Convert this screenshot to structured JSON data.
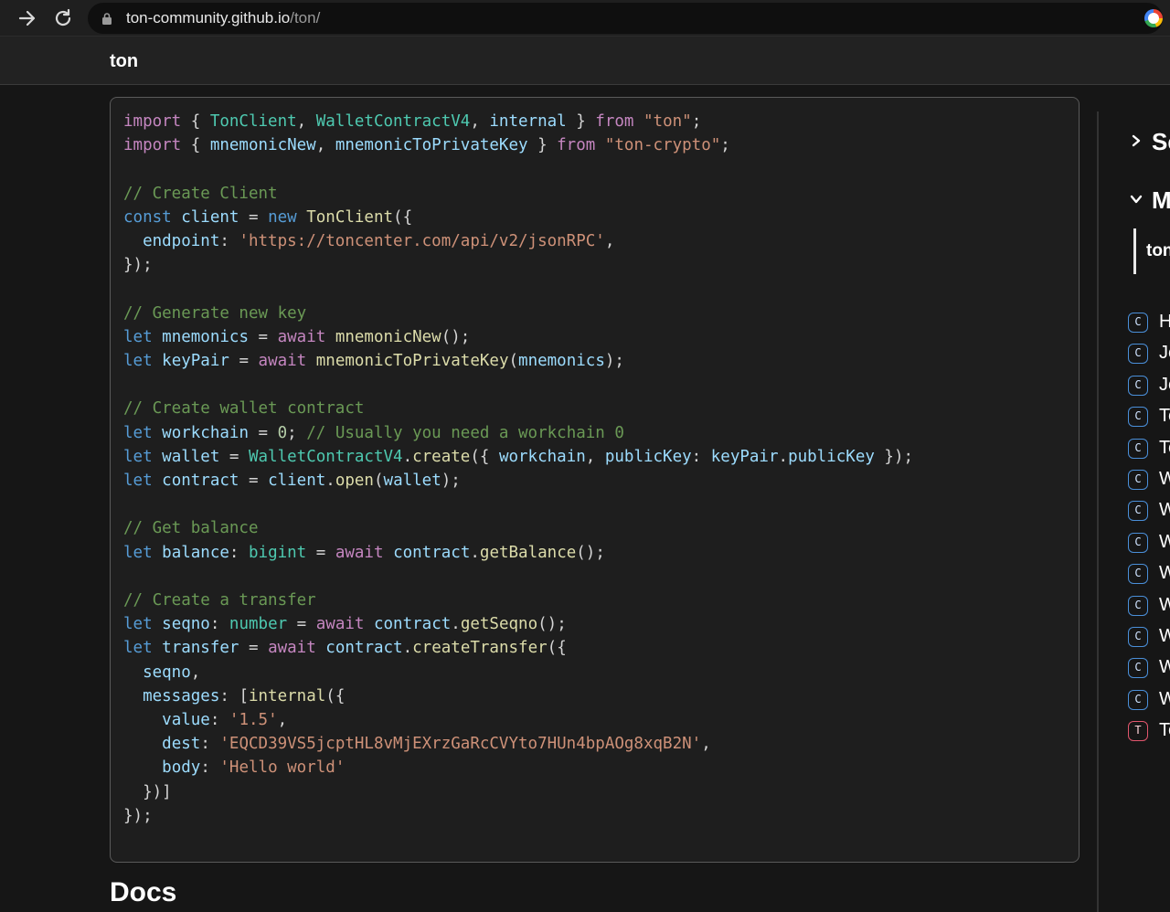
{
  "browser": {
    "url_host": "ton-community.github.io",
    "url_path": "/ton/"
  },
  "header": {
    "title": "ton"
  },
  "code": {
    "lines": [
      [
        [
          "kw",
          "import"
        ],
        [
          "p",
          " { "
        ],
        [
          "ty",
          "TonClient"
        ],
        [
          "p",
          ", "
        ],
        [
          "ty",
          "WalletContractV4"
        ],
        [
          "p",
          ", "
        ],
        [
          "v",
          "internal"
        ],
        [
          "p",
          " } "
        ],
        [
          "kw",
          "from"
        ],
        [
          "p",
          " "
        ],
        [
          "str",
          "\"ton\""
        ],
        [
          "p",
          ";"
        ]
      ],
      [
        [
          "kw",
          "import"
        ],
        [
          "p",
          " { "
        ],
        [
          "v",
          "mnemonicNew"
        ],
        [
          "p",
          ", "
        ],
        [
          "v",
          "mnemonicToPrivateKey"
        ],
        [
          "p",
          " } "
        ],
        [
          "kw",
          "from"
        ],
        [
          "p",
          " "
        ],
        [
          "str",
          "\"ton-crypto\""
        ],
        [
          "p",
          ";"
        ]
      ],
      [],
      [
        [
          "cm",
          "// Create Client"
        ]
      ],
      [
        [
          "kb",
          "const"
        ],
        [
          "p",
          " "
        ],
        [
          "v",
          "client"
        ],
        [
          "p",
          " = "
        ],
        [
          "kb",
          "new"
        ],
        [
          "p",
          " "
        ],
        [
          "fn",
          "TonClient"
        ],
        [
          "p",
          "({"
        ]
      ],
      [
        [
          "p",
          "  "
        ],
        [
          "v",
          "endpoint"
        ],
        [
          "p",
          ": "
        ],
        [
          "str",
          "'https://toncenter.com/api/v2/jsonRPC'"
        ],
        [
          "p",
          ","
        ]
      ],
      [
        [
          "p",
          "});"
        ]
      ],
      [],
      [
        [
          "cm",
          "// Generate new key"
        ]
      ],
      [
        [
          "kb",
          "let"
        ],
        [
          "p",
          " "
        ],
        [
          "v",
          "mnemonics"
        ],
        [
          "p",
          " = "
        ],
        [
          "kw",
          "await"
        ],
        [
          "p",
          " "
        ],
        [
          "fn",
          "mnemonicNew"
        ],
        [
          "p",
          "();"
        ]
      ],
      [
        [
          "kb",
          "let"
        ],
        [
          "p",
          " "
        ],
        [
          "v",
          "keyPair"
        ],
        [
          "p",
          " = "
        ],
        [
          "kw",
          "await"
        ],
        [
          "p",
          " "
        ],
        [
          "fn",
          "mnemonicToPrivateKey"
        ],
        [
          "p",
          "("
        ],
        [
          "v",
          "mnemonics"
        ],
        [
          "p",
          ");"
        ]
      ],
      [],
      [
        [
          "cm",
          "// Create wallet contract"
        ]
      ],
      [
        [
          "kb",
          "let"
        ],
        [
          "p",
          " "
        ],
        [
          "v",
          "workchain"
        ],
        [
          "p",
          " = "
        ],
        [
          "num",
          "0"
        ],
        [
          "p",
          "; "
        ],
        [
          "cm",
          "// Usually you need a workchain 0"
        ]
      ],
      [
        [
          "kb",
          "let"
        ],
        [
          "p",
          " "
        ],
        [
          "v",
          "wallet"
        ],
        [
          "p",
          " = "
        ],
        [
          "ty",
          "WalletContractV4"
        ],
        [
          "p",
          "."
        ],
        [
          "fn",
          "create"
        ],
        [
          "p",
          "({ "
        ],
        [
          "v",
          "workchain"
        ],
        [
          "p",
          ", "
        ],
        [
          "v",
          "publicKey"
        ],
        [
          "p",
          ": "
        ],
        [
          "v",
          "keyPair"
        ],
        [
          "p",
          "."
        ],
        [
          "v",
          "publicKey"
        ],
        [
          "p",
          " });"
        ]
      ],
      [
        [
          "kb",
          "let"
        ],
        [
          "p",
          " "
        ],
        [
          "v",
          "contract"
        ],
        [
          "p",
          " = "
        ],
        [
          "v",
          "client"
        ],
        [
          "p",
          "."
        ],
        [
          "fn",
          "open"
        ],
        [
          "p",
          "("
        ],
        [
          "v",
          "wallet"
        ],
        [
          "p",
          ");"
        ]
      ],
      [],
      [
        [
          "cm",
          "// Get balance"
        ]
      ],
      [
        [
          "kb",
          "let"
        ],
        [
          "p",
          " "
        ],
        [
          "v",
          "balance"
        ],
        [
          "p",
          ": "
        ],
        [
          "ty",
          "bigint"
        ],
        [
          "p",
          " = "
        ],
        [
          "kw",
          "await"
        ],
        [
          "p",
          " "
        ],
        [
          "v",
          "contract"
        ],
        [
          "p",
          "."
        ],
        [
          "fn",
          "getBalance"
        ],
        [
          "p",
          "();"
        ]
      ],
      [],
      [
        [
          "cm",
          "// Create a transfer"
        ]
      ],
      [
        [
          "kb",
          "let"
        ],
        [
          "p",
          " "
        ],
        [
          "v",
          "seqno"
        ],
        [
          "p",
          ": "
        ],
        [
          "ty",
          "number"
        ],
        [
          "p",
          " = "
        ],
        [
          "kw",
          "await"
        ],
        [
          "p",
          " "
        ],
        [
          "v",
          "contract"
        ],
        [
          "p",
          "."
        ],
        [
          "fn",
          "getSeqno"
        ],
        [
          "p",
          "();"
        ]
      ],
      [
        [
          "kb",
          "let"
        ],
        [
          "p",
          " "
        ],
        [
          "v",
          "transfer"
        ],
        [
          "p",
          " = "
        ],
        [
          "kw",
          "await"
        ],
        [
          "p",
          " "
        ],
        [
          "v",
          "contract"
        ],
        [
          "p",
          "."
        ],
        [
          "fn",
          "createTransfer"
        ],
        [
          "p",
          "({"
        ]
      ],
      [
        [
          "p",
          "  "
        ],
        [
          "v",
          "seqno"
        ],
        [
          "p",
          ","
        ]
      ],
      [
        [
          "p",
          "  "
        ],
        [
          "v",
          "messages"
        ],
        [
          "p",
          ": ["
        ],
        [
          "fn",
          "internal"
        ],
        [
          "p",
          "({"
        ]
      ],
      [
        [
          "p",
          "    "
        ],
        [
          "v",
          "value"
        ],
        [
          "p",
          ": "
        ],
        [
          "str",
          "'1.5'"
        ],
        [
          "p",
          ","
        ]
      ],
      [
        [
          "p",
          "    "
        ],
        [
          "v",
          "dest"
        ],
        [
          "p",
          ": "
        ],
        [
          "str",
          "'EQCD39VS5jcptHL8vMjEXrzGaRcCVYto7HUn4bpAOg8xqB2N'"
        ],
        [
          "p",
          ","
        ]
      ],
      [
        [
          "p",
          "    "
        ],
        [
          "v",
          "body"
        ],
        [
          "p",
          ": "
        ],
        [
          "str",
          "'Hello world'"
        ]
      ],
      [
        [
          "p",
          "  })]"
        ]
      ],
      [
        [
          "p",
          "});"
        ]
      ]
    ]
  },
  "docs_heading": "Docs",
  "sidebar": {
    "sections": [
      {
        "title": "Se",
        "icon": "chevron-right-icon"
      },
      {
        "title": "M",
        "icon": "chevron-down-icon"
      }
    ],
    "active_item": "ton",
    "items": [
      {
        "kind": "C",
        "label": "H"
      },
      {
        "kind": "C",
        "label": "Je"
      },
      {
        "kind": "C",
        "label": "Je"
      },
      {
        "kind": "C",
        "label": "Te"
      },
      {
        "kind": "C",
        "label": "Te"
      },
      {
        "kind": "C",
        "label": "W"
      },
      {
        "kind": "C",
        "label": "W"
      },
      {
        "kind": "C",
        "label": "W"
      },
      {
        "kind": "C",
        "label": "W"
      },
      {
        "kind": "C",
        "label": "W"
      },
      {
        "kind": "C",
        "label": "W"
      },
      {
        "kind": "C",
        "label": "W"
      },
      {
        "kind": "C",
        "label": "W"
      },
      {
        "kind": "T",
        "label": "Te"
      }
    ]
  }
}
